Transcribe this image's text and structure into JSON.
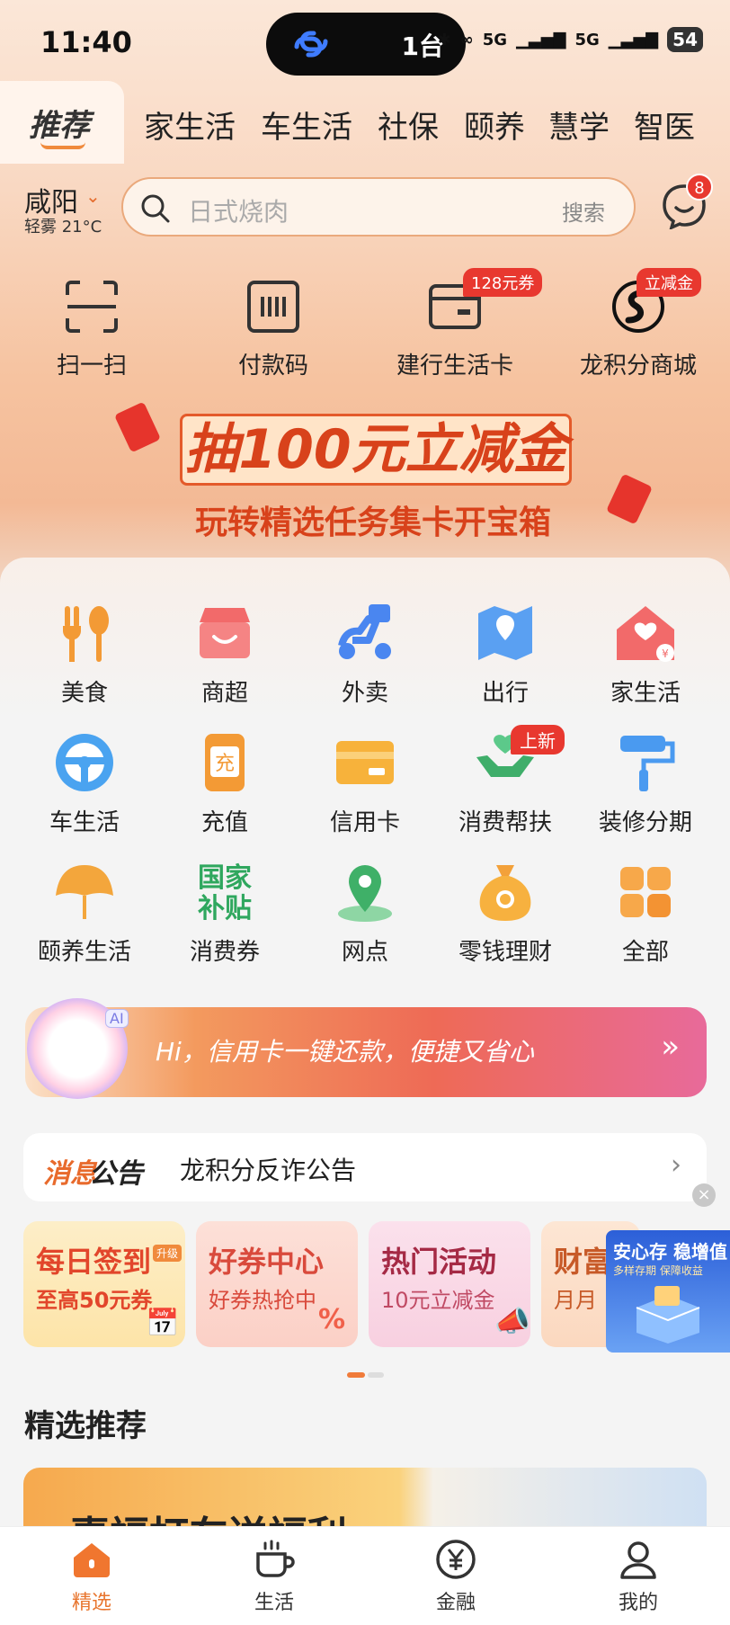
{
  "status_bar": {
    "time": "11:40",
    "island_count": "1台",
    "battery": "54",
    "net1": "5G",
    "net2": "5G"
  },
  "top_tabs": {
    "active": "推荐",
    "items": [
      "家生活",
      "车生活",
      "社保",
      "颐养",
      "慧学",
      "智医"
    ]
  },
  "location": {
    "city": "咸阳",
    "weather": "轻雾 21°C"
  },
  "search": {
    "placeholder": "日式烧肉",
    "button": "搜索"
  },
  "messages": {
    "badge": "8"
  },
  "quick_actions": [
    {
      "label": "扫一扫",
      "icon": "scan-icon"
    },
    {
      "label": "付款码",
      "icon": "barcode-icon"
    },
    {
      "label": "建行生活卡",
      "icon": "wallet-card-icon",
      "tag": "128元券"
    },
    {
      "label": "龙积分商城",
      "icon": "dragon-points-icon",
      "tag": "立减金"
    }
  ],
  "banner": {
    "title": "抽100元立减金",
    "subtitle": "玩转精选任务集卡开宝箱"
  },
  "services": [
    {
      "label": "美食",
      "icon": "fork-spoon-icon"
    },
    {
      "label": "商超",
      "icon": "store-icon"
    },
    {
      "label": "外卖",
      "icon": "scooter-icon"
    },
    {
      "label": "出行",
      "icon": "map-pin-icon"
    },
    {
      "label": "家生活",
      "icon": "house-icon"
    },
    {
      "label": "车生活",
      "icon": "steering-wheel-icon"
    },
    {
      "label": "充值",
      "icon": "recharge-icon"
    },
    {
      "label": "信用卡",
      "icon": "credit-card-icon"
    },
    {
      "label": "消费帮扶",
      "icon": "helping-hand-icon",
      "tag": "上新"
    },
    {
      "label": "装修分期",
      "icon": "paint-roller-icon"
    },
    {
      "label": "颐养生活",
      "icon": "ginkgo-icon"
    },
    {
      "label": "消费券",
      "icon": "subsidy-icon",
      "icon_text": "国家补贴"
    },
    {
      "label": "网点",
      "icon": "location-icon"
    },
    {
      "label": "零钱理财",
      "icon": "money-bag-icon"
    },
    {
      "label": "全部",
      "icon": "grid-icon"
    }
  ],
  "ai_banner": {
    "tag": "AI",
    "text": "Hi，信用卡一键还款，便捷又省心",
    "arrow": "»"
  },
  "notice": {
    "label_a": "消息",
    "label_b": "公告",
    "text": "龙积分反诈公告"
  },
  "promos": [
    {
      "title": "每日签到",
      "sub": "至高50元券",
      "badge": "升级"
    },
    {
      "title": "好券中心",
      "sub": "好券热抢中"
    },
    {
      "title": "热门活动",
      "sub": "10元立减金"
    },
    {
      "title": "财富",
      "sub": "月月"
    }
  ],
  "float_ad": {
    "title": "安心存 稳增值",
    "sub": "多样存期 保障收益"
  },
  "section": {
    "title": "精选推荐"
  },
  "recommend_card": {
    "title": "惠福打车送福利"
  },
  "bottom_nav": [
    {
      "label": "精选",
      "icon": "home-icon",
      "active": true
    },
    {
      "label": "生活",
      "icon": "cup-icon"
    },
    {
      "label": "金融",
      "icon": "yuan-icon"
    },
    {
      "label": "我的",
      "icon": "person-icon"
    }
  ],
  "colors": {
    "accent": "#e8762f",
    "red": "#e8382f",
    "banner_red": "#d8421b"
  }
}
